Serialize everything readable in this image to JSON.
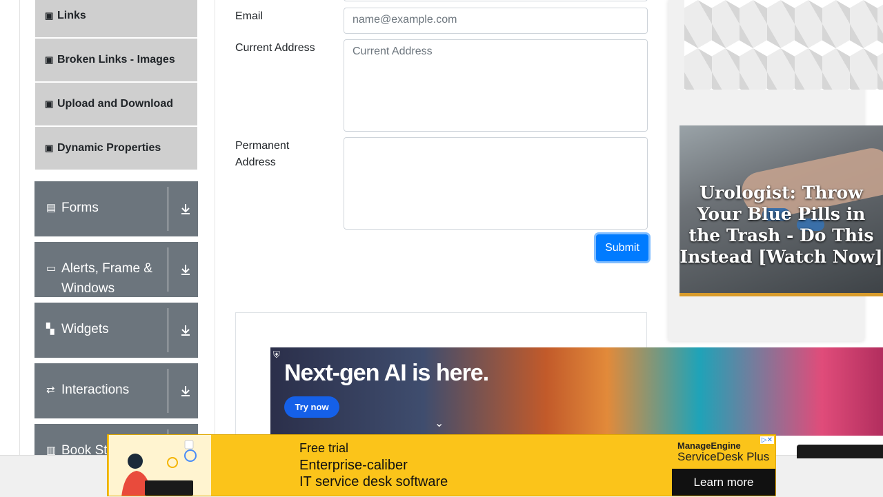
{
  "sidebar": {
    "sub_items": [
      {
        "label": "Links"
      },
      {
        "label": "Broken Links - Images"
      },
      {
        "label": "Upload and Download"
      },
      {
        "label": "Dynamic Properties"
      }
    ],
    "groups": [
      {
        "label": "Forms"
      },
      {
        "label": "Alerts, Frame & Windows"
      },
      {
        "label": "Widgets"
      },
      {
        "label": "Interactions"
      },
      {
        "label": "Book Store Application"
      }
    ]
  },
  "form": {
    "email_label": "Email",
    "email_placeholder": "name@example.com",
    "current_address_label": "Current Address",
    "current_address_placeholder": "Current Address",
    "permanent_address_label": "Permanent Address",
    "submit_label": "Submit"
  },
  "ads": {
    "urologist_text": "Urologist: Throw Your Blue Pills in the Trash - Do This Instead [Watch Now]",
    "ai_headline": "Next-gen AI is here.",
    "ai_button": "Try now",
    "sd_small": "Free trial",
    "sd_line1": "Enterprise-caliber",
    "sd_line2": "IT service desk software",
    "sd_brand_top": "ManageEngine",
    "sd_brand_name": "ServiceDesk Plus",
    "sd_cta": "Learn more"
  }
}
